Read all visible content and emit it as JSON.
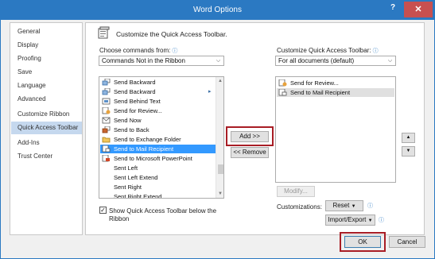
{
  "window": {
    "title": "Word Options",
    "help_label": "?",
    "close_label": "✕"
  },
  "nav": {
    "items": [
      {
        "label": "General"
      },
      {
        "label": "Display"
      },
      {
        "label": "Proofing"
      },
      {
        "label": "Save"
      },
      {
        "label": "Language"
      },
      {
        "label": "Advanced"
      },
      {
        "label": "Customize Ribbon"
      },
      {
        "label": "Quick Access Toolbar",
        "selected": true
      },
      {
        "label": "Add-Ins"
      },
      {
        "label": "Trust Center"
      }
    ]
  },
  "header": {
    "title": "Customize the Quick Access Toolbar."
  },
  "left": {
    "choose_label": "Choose commands from:",
    "choose_value": "Commands Not in the Ribbon",
    "commands": [
      {
        "label": "Send Backward",
        "icon": "send-backward-icon"
      },
      {
        "label": "Send Backward",
        "icon": "send-backward-icon",
        "submenu": true
      },
      {
        "label": "Send Behind Text",
        "icon": "send-behind-text-icon"
      },
      {
        "label": "Send for Review...",
        "icon": "send-for-review-icon"
      },
      {
        "label": "Send Now",
        "icon": "send-now-icon"
      },
      {
        "label": "Send to Back",
        "icon": "send-to-back-icon"
      },
      {
        "label": "Send to Exchange Folder",
        "icon": "exchange-folder-icon"
      },
      {
        "label": "Send to Mail Recipient",
        "icon": "mail-recipient-icon",
        "selected": true
      },
      {
        "label": "Send to Microsoft PowerPoint",
        "icon": "powerpoint-icon"
      },
      {
        "label": "Sent Left",
        "icon": ""
      },
      {
        "label": "Sent Left Extend",
        "icon": ""
      },
      {
        "label": "Sent Right",
        "icon": ""
      },
      {
        "label": "Sent Right Extend",
        "icon": ""
      }
    ],
    "show_below_label_line1": "Show Quick Access Toolbar below the",
    "show_below_label_line2": "Ribbon",
    "show_below_checked": "✓"
  },
  "middle": {
    "add_label": "Add >>",
    "remove_label": "<< Remove"
  },
  "right": {
    "customize_label": "Customize Quick Access Toolbar:",
    "customize_value": "For all documents (default)",
    "toolbar_items": [
      {
        "label": "Send for Review...",
        "icon": "send-for-review-icon"
      },
      {
        "label": "Send to Mail Recipient",
        "icon": "mail-recipient-icon",
        "selected": true
      }
    ],
    "modify_label": "Modify...",
    "customizations_label": "Customizations:",
    "reset_label": "Reset",
    "import_export_label": "Import/Export",
    "move_up": "▲",
    "move_down": "▼"
  },
  "footer": {
    "ok_label": "OK",
    "cancel_label": "Cancel"
  },
  "colors": {
    "titlebar": "#2b79c2",
    "highlight_box": "#a81d25",
    "selection": "#3399ff"
  }
}
